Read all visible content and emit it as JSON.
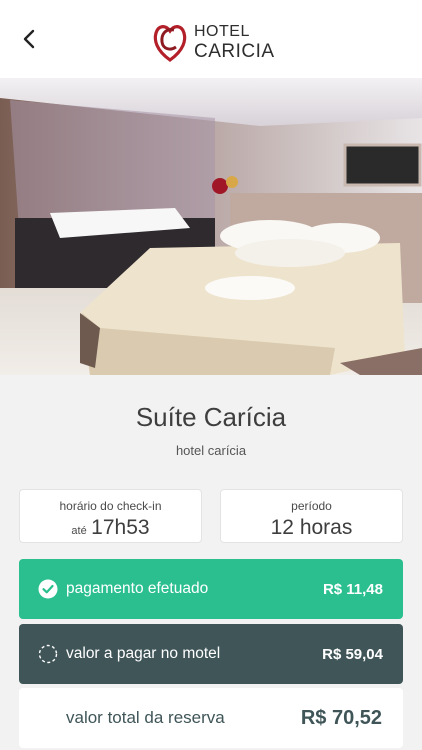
{
  "header": {
    "back_icon": "chevron-left-icon",
    "logo_line1": "HOTEL",
    "logo_line2": "CARICIA",
    "brand_color": "#b3202a"
  },
  "room": {
    "title": "Suíte Carícia",
    "subtitle": "hotel carícia"
  },
  "checkin": {
    "label": "horário do check-in",
    "prefix": "até",
    "value": "17h53"
  },
  "period": {
    "label": "período",
    "value": "12 horas"
  },
  "payments": {
    "paid_label": "pagamento efetuado",
    "paid_amount": "R$ 11,48",
    "paid_color": "#2bbf8f",
    "due_label": "valor a pagar no motel",
    "due_amount": "R$ 59,04",
    "due_color": "#3f5558"
  },
  "total": {
    "label": "valor total da reserva",
    "amount": "R$ 70,52"
  }
}
